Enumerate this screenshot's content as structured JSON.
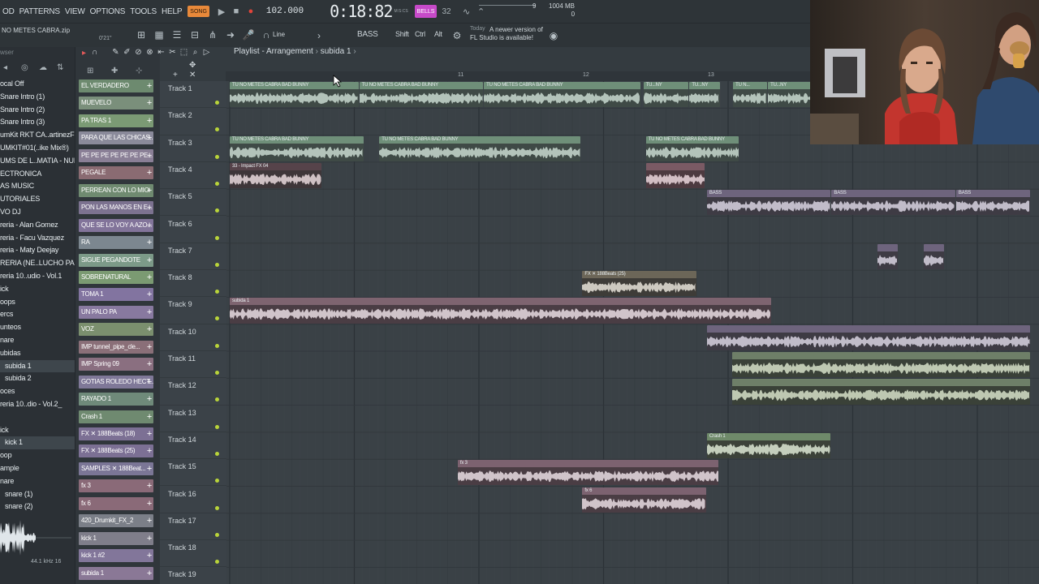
{
  "menu": {
    "items": [
      "OD",
      "PATTERNS",
      "VIEW",
      "OPTIONS",
      "TOOLS",
      "HELP"
    ],
    "song_label": "SONG",
    "tempo": "102.000",
    "time": "0:18:82",
    "time_unit": "M:S:CS",
    "pattern_label": "BELLS",
    "pattern_num": "32",
    "cpu_num": "9",
    "mem": "1004 MB",
    "mem_sub": "0"
  },
  "toolbar2": {
    "project_name": "NO METES CABRA.zip",
    "project_time": "0'21\"",
    "snap": "Line",
    "bass": "BASS",
    "shift": "Shift",
    "ctrl": "Ctrl",
    "alt": "Alt",
    "news_day": "Today",
    "news_line1": "A newer version of",
    "news_line2": "FL Studio is available!"
  },
  "browser": {
    "label": "wser",
    "items": [
      {
        "label": "ocal Off",
        "sel": false,
        "ind": false
      },
      {
        "label": "Snare Intro (1)",
        "sel": false,
        "ind": false
      },
      {
        "label": "Snare Intro (2)",
        "sel": false,
        "ind": false
      },
      {
        "label": "Snare Intro (3)",
        "sel": false,
        "ind": false
      },
      {
        "label": "umKit RKT CA..artinezFlp",
        "sel": false,
        "ind": false
      },
      {
        "label": "UMKIT#01(..ike Mix®)",
        "sel": false,
        "ind": false
      },
      {
        "label": "UMS DE L..MATIA - NUBE",
        "sel": false,
        "ind": false
      },
      {
        "label": "ECTRONICA",
        "sel": false,
        "ind": false
      },
      {
        "label": "AS MUSIC",
        "sel": false,
        "ind": false
      },
      {
        "label": "UTORIALES",
        "sel": false,
        "ind": false
      },
      {
        "label": "VO DJ",
        "sel": false,
        "ind": false
      },
      {
        "label": "reria - Alan Gomez",
        "sel": false,
        "ind": false
      },
      {
        "label": "reria - Facu Vazquez",
        "sel": false,
        "ind": false
      },
      {
        "label": "reria - Maty Deejay",
        "sel": false,
        "ind": false
      },
      {
        "label": "RERIA (NE..LUCHO PAPA",
        "sel": false,
        "ind": false
      },
      {
        "label": "reria 10..udio - Vol.1",
        "sel": false,
        "ind": false
      },
      {
        "label": "ick",
        "sel": false,
        "ind": false
      },
      {
        "label": "oops",
        "sel": false,
        "ind": false
      },
      {
        "label": "ercs",
        "sel": false,
        "ind": false
      },
      {
        "label": "unteos",
        "sel": false,
        "ind": false
      },
      {
        "label": "nare",
        "sel": false,
        "ind": false
      },
      {
        "label": "ubidas",
        "sel": false,
        "ind": false
      },
      {
        "label": "subida 1",
        "sel": true,
        "ind": true
      },
      {
        "label": "subida 2",
        "sel": false,
        "ind": true
      },
      {
        "label": "oces",
        "sel": false,
        "ind": false
      },
      {
        "label": "reria 10..dio - Vol.2_",
        "sel": false,
        "ind": false
      },
      {
        "label": "",
        "sel": false,
        "ind": false
      },
      {
        "label": "ick",
        "sel": false,
        "ind": false
      },
      {
        "label": "kick 1",
        "sel": true,
        "ind": true
      },
      {
        "label": "oop",
        "sel": false,
        "ind": false
      },
      {
        "label": "ample",
        "sel": false,
        "ind": false
      },
      {
        "label": "nare",
        "sel": false,
        "ind": false
      },
      {
        "label": "snare (1)",
        "sel": false,
        "ind": true
      },
      {
        "label": "snare (2)",
        "sel": false,
        "ind": true
      }
    ],
    "freq": "44.1 kHz 16"
  },
  "channels": [
    {
      "label": "EL VERDADERO",
      "color": "#6d8a6f"
    },
    {
      "label": "MUEVELO",
      "color": "#7a8f7b"
    },
    {
      "label": "PA TRAS 1",
      "color": "#7b9a74"
    },
    {
      "label": "PARA QUE LAS CHICAS...",
      "color": "#8a8a9a"
    },
    {
      "label": "PE PE PE PE PE PE PE...",
      "color": "#8a7f96"
    },
    {
      "label": "PEGALE",
      "color": "#8a6b72"
    },
    {
      "label": "PERREAN CON LO MIO",
      "color": "#6f8a70"
    },
    {
      "label": "PON LAS MANOS EN E...",
      "color": "#7c7290"
    },
    {
      "label": "QUE SE LO VOY A AZO...",
      "color": "#82749a"
    },
    {
      "label": "RA",
      "color": "#7c8790"
    },
    {
      "label": "SIGUE PEGANDOTE",
      "color": "#7c9a88"
    },
    {
      "label": "SOBRENATURAL",
      "color": "#7b9a72"
    },
    {
      "label": "TOMA 1",
      "color": "#8274a0"
    },
    {
      "label": "UN PALO PA",
      "color": "#88799f"
    },
    {
      "label": "VOZ",
      "color": "#7b8f6e"
    },
    {
      "label": "IMP tunnel_pipe_cle...",
      "color": "#8a6f78"
    },
    {
      "label": "IMP Spring 09",
      "color": "#8a6f80"
    },
    {
      "label": "GOTIAS ROLEDO HECT...",
      "color": "#7f7898"
    },
    {
      "label": "RAYADO 1",
      "color": "#6f8a7a"
    },
    {
      "label": "Crash 1",
      "color": "#6f8a70"
    },
    {
      "label": "FX ✕ 188Beats (18)",
      "color": "#7c7094"
    },
    {
      "label": "FX ✕ 188Beats (25)",
      "color": "#7c7094"
    },
    {
      "label": "SAMPLES ✕ 188Beat...",
      "color": "#7b7696"
    },
    {
      "label": "fx 3",
      "color": "#8a6a78"
    },
    {
      "label": "fx 6",
      "color": "#8a6a78"
    },
    {
      "label": "420_Drumkit_FX_2",
      "color": "#7b7f88"
    },
    {
      "label": "kick 1",
      "color": "#7f7e8a"
    },
    {
      "label": "kick 1 #2",
      "color": "#82769a"
    },
    {
      "label": "subida 1",
      "color": "#8a7896"
    }
  ],
  "playlist": {
    "title": "Playlist - Arrangement",
    "pattern": "subida 1",
    "ruler": [
      "11",
      "12",
      "13"
    ],
    "tracks": [
      "Track 1",
      "Track 2",
      "Track 3",
      "Track 4",
      "Track 5",
      "Track 6",
      "Track 7",
      "Track 8",
      "Track 9",
      "Track 10",
      "Track 11",
      "Track 12",
      "Track 13",
      "Track 14",
      "Track 15",
      "Track 16",
      "Track 17",
      "Track 18",
      "Track 19"
    ]
  },
  "clips": [
    {
      "track": 1,
      "bar": 0,
      "len": 1.04,
      "label": "TU NO METES CABRA BAD BUNNY",
      "color": "#6f8f79",
      "body": "#3f4a46",
      "wave": "#c8d8cf"
    },
    {
      "track": 1,
      "bar": 1.04,
      "len": 1.0,
      "label": "TU NO METES CABRA BAD BUNNY",
      "color": "#6f8f79",
      "body": "#3f4a46",
      "wave": "#c8d8cf"
    },
    {
      "track": 1,
      "bar": 2.04,
      "len": 1.26,
      "label": "TU NO METES CABRA BAD BUNNY",
      "color": "#6f8f79",
      "body": "#3f4a46",
      "wave": "#c8d8cf"
    },
    {
      "track": 1,
      "bar": 3.32,
      "len": 0.37,
      "label": "TU...NY",
      "color": "#6f8f79",
      "body": "#3f4a46",
      "wave": "#c8d8cf"
    },
    {
      "track": 1,
      "bar": 3.69,
      "len": 0.25,
      "label": "TU...NY",
      "color": "#6f8f79",
      "body": "#3f4a46",
      "wave": "#c8d8cf"
    },
    {
      "track": 1,
      "bar": 4.04,
      "len": 0.28,
      "label": "TU N...",
      "color": "#6f8f79",
      "body": "#3f4a46",
      "wave": "#c8d8cf"
    },
    {
      "track": 1,
      "bar": 4.32,
      "len": 0.37,
      "label": "TU...NY",
      "color": "#6f8f79",
      "body": "#3f4a46",
      "wave": "#c8d8cf"
    },
    {
      "track": 1,
      "bar": 4.69,
      "len": 0.35,
      "label": "TU N...",
      "color": "#6f8f79",
      "body": "#3f4a46",
      "wave": "#c8d8cf"
    },
    {
      "track": 3,
      "bar": 0,
      "len": 1.08,
      "label": "TU NO METES CABRA BAD BUNNY",
      "color": "#6f8f79",
      "body": "#3f4a46",
      "wave": "#c8d8cf"
    },
    {
      "track": 3,
      "bar": 1.2,
      "len": 1.62,
      "label": "TU NO METES CABRA BAD BUNNY",
      "color": "#6f8f79",
      "body": "#3f4a46",
      "wave": "#c8d8cf"
    },
    {
      "track": 3,
      "bar": 3.34,
      "len": 0.75,
      "label": "TU NO METES CABRA BAD BUNNY",
      "color": "#6f8f79",
      "body": "#3f4a46",
      "wave": "#c8d8cf"
    },
    {
      "track": 4,
      "bar": 0,
      "len": 0.74,
      "label": "33 - Impact FX 04",
      "color": "#56434a",
      "body": "#3e3639",
      "wave": "#e8d8dc"
    },
    {
      "track": 4,
      "bar": 3.34,
      "len": 0.48,
      "label": "",
      "color": "#7a5a64",
      "body": "#4d3a40",
      "wave": "#ead6dc"
    },
    {
      "track": 5,
      "bar": 3.83,
      "len": 1.0,
      "label": "BASS",
      "color": "#6e647d",
      "body": "#3e3b44",
      "wave": "#d8d4e0"
    },
    {
      "track": 5,
      "bar": 4.83,
      "len": 1.0,
      "label": "BASS",
      "color": "#6e647d",
      "body": "#3e3b44",
      "wave": "#d8d4e0"
    },
    {
      "track": 5,
      "bar": 5.83,
      "len": 0.6,
      "label": "BASS",
      "color": "#6e647d",
      "body": "#3e3b44",
      "wave": "#d8d4e0"
    },
    {
      "track": 7,
      "bar": 5.2,
      "len": 0.17,
      "label": "",
      "color": "#6e647d",
      "body": "#3e3b44",
      "wave": "#d8d4e0"
    },
    {
      "track": 7,
      "bar": 5.57,
      "len": 0.17,
      "label": "",
      "color": "#6e647d",
      "body": "#3e3b44",
      "wave": "#d8d4e0"
    },
    {
      "track": 8,
      "bar": 2.83,
      "len": 0.92,
      "label": "FX ✕ 188Beats (25)",
      "color": "#6c6658",
      "body": "#3e3c38",
      "wave": "#e6e2d8"
    },
    {
      "track": 9,
      "bar": 0,
      "len": 4.35,
      "label": "subida 1",
      "color": "#7e6470",
      "body": "#4a3d44",
      "wave": "#e8dce2"
    },
    {
      "track": 10,
      "bar": 3.83,
      "len": 2.6,
      "label": "",
      "color": "#6e647d",
      "body": "#3e3b44",
      "wave": "#d8d4e0"
    },
    {
      "track": 11,
      "bar": 4.03,
      "len": 2.4,
      "label": "",
      "color": "#6e7f68",
      "body": "#3a4138",
      "wave": "#d6e0c8"
    },
    {
      "track": 12,
      "bar": 4.03,
      "len": 2.4,
      "label": "",
      "color": "#6e7f68",
      "body": "#3a4138",
      "wave": "#d6e0c8"
    },
    {
      "track": 14,
      "bar": 3.83,
      "len": 1.0,
      "label": "Crash 1",
      "color": "#6f8a6a",
      "body": "#3c4239",
      "wave": "#dce6d4"
    },
    {
      "track": 15,
      "bar": 1.83,
      "len": 2.1,
      "label": "fx 3",
      "color": "#7c6270",
      "body": "#4a3d44",
      "wave": "#e8dce2"
    },
    {
      "track": 16,
      "bar": 2.83,
      "len": 1.0,
      "label": "fx 6",
      "color": "#7c6270",
      "body": "#4a3d44",
      "wave": "#e8dce2"
    }
  ]
}
